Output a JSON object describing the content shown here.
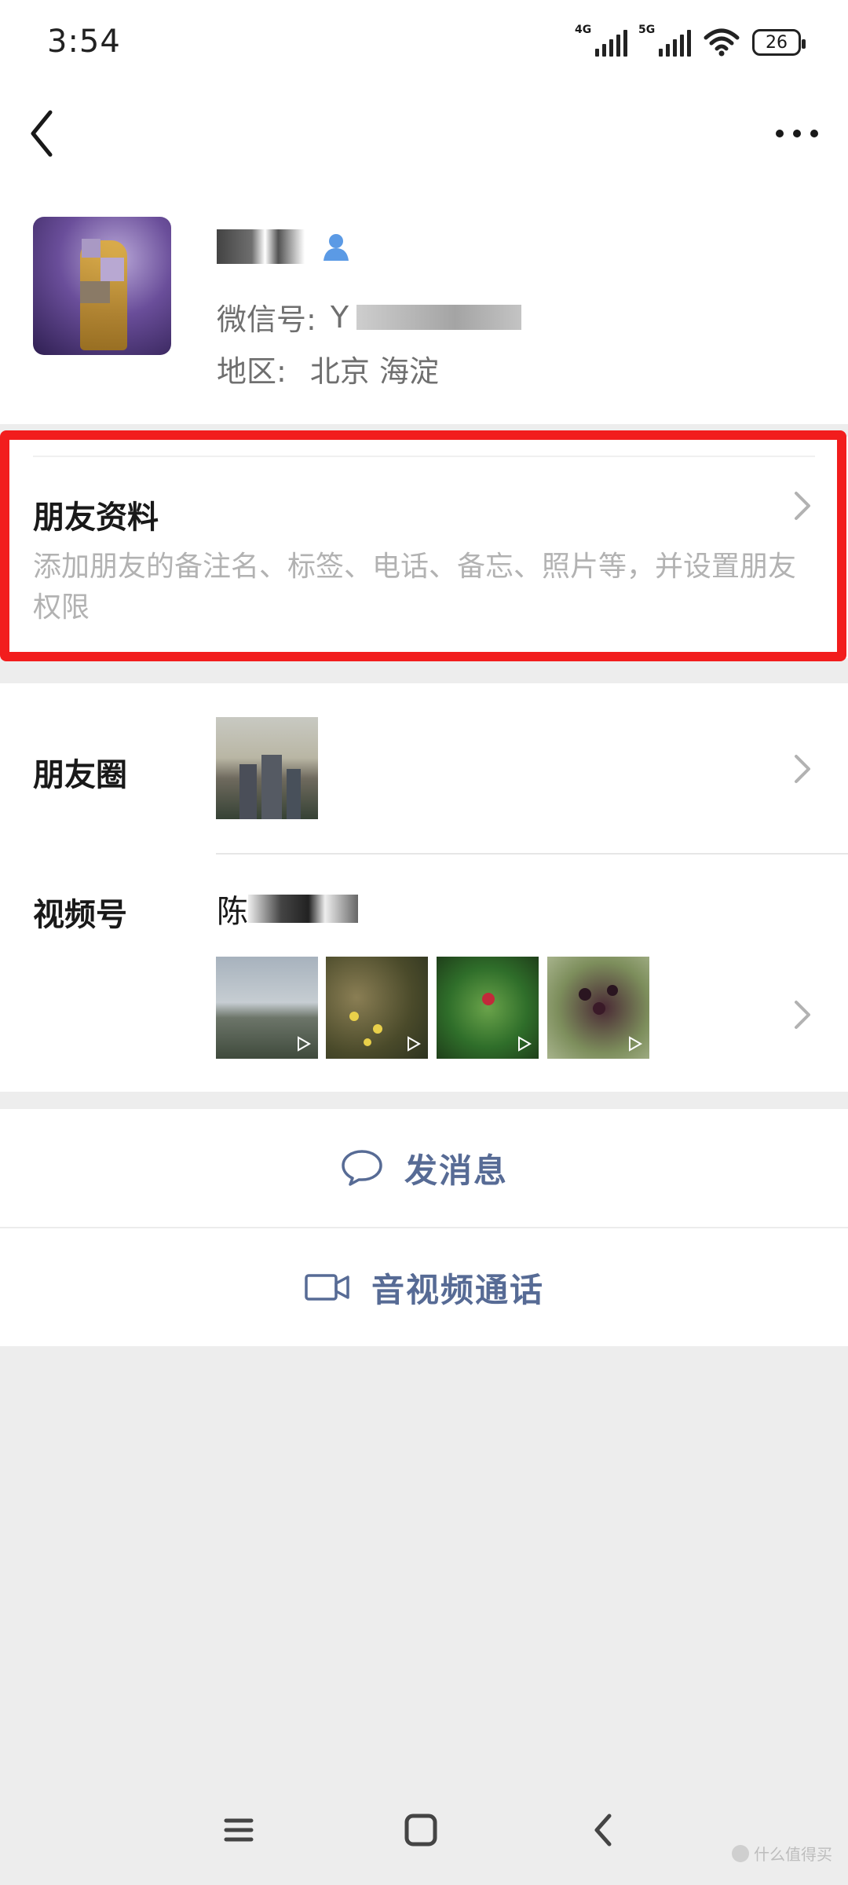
{
  "status_bar": {
    "time": "3:54",
    "network1": "4G",
    "network2": "5G",
    "battery": "26"
  },
  "profile": {
    "wechat_id_label": "微信号:",
    "wechat_id_visible": "Y",
    "region_label": "地区:",
    "region_value": "北京  海淀"
  },
  "friend_info": {
    "title": "朋友资料",
    "description": "添加朋友的备注名、标签、电话、备忘、照片等，并设置朋友权限"
  },
  "moments": {
    "label": "朋友圈"
  },
  "channels": {
    "label": "视频号",
    "name_visible": "陈"
  },
  "actions": {
    "message": "发消息",
    "call": "音视频通话"
  },
  "watermark": "什么值得买",
  "colors": {
    "accent": "#576b95",
    "highlight": "#f21d1d",
    "background": "#ededed"
  }
}
